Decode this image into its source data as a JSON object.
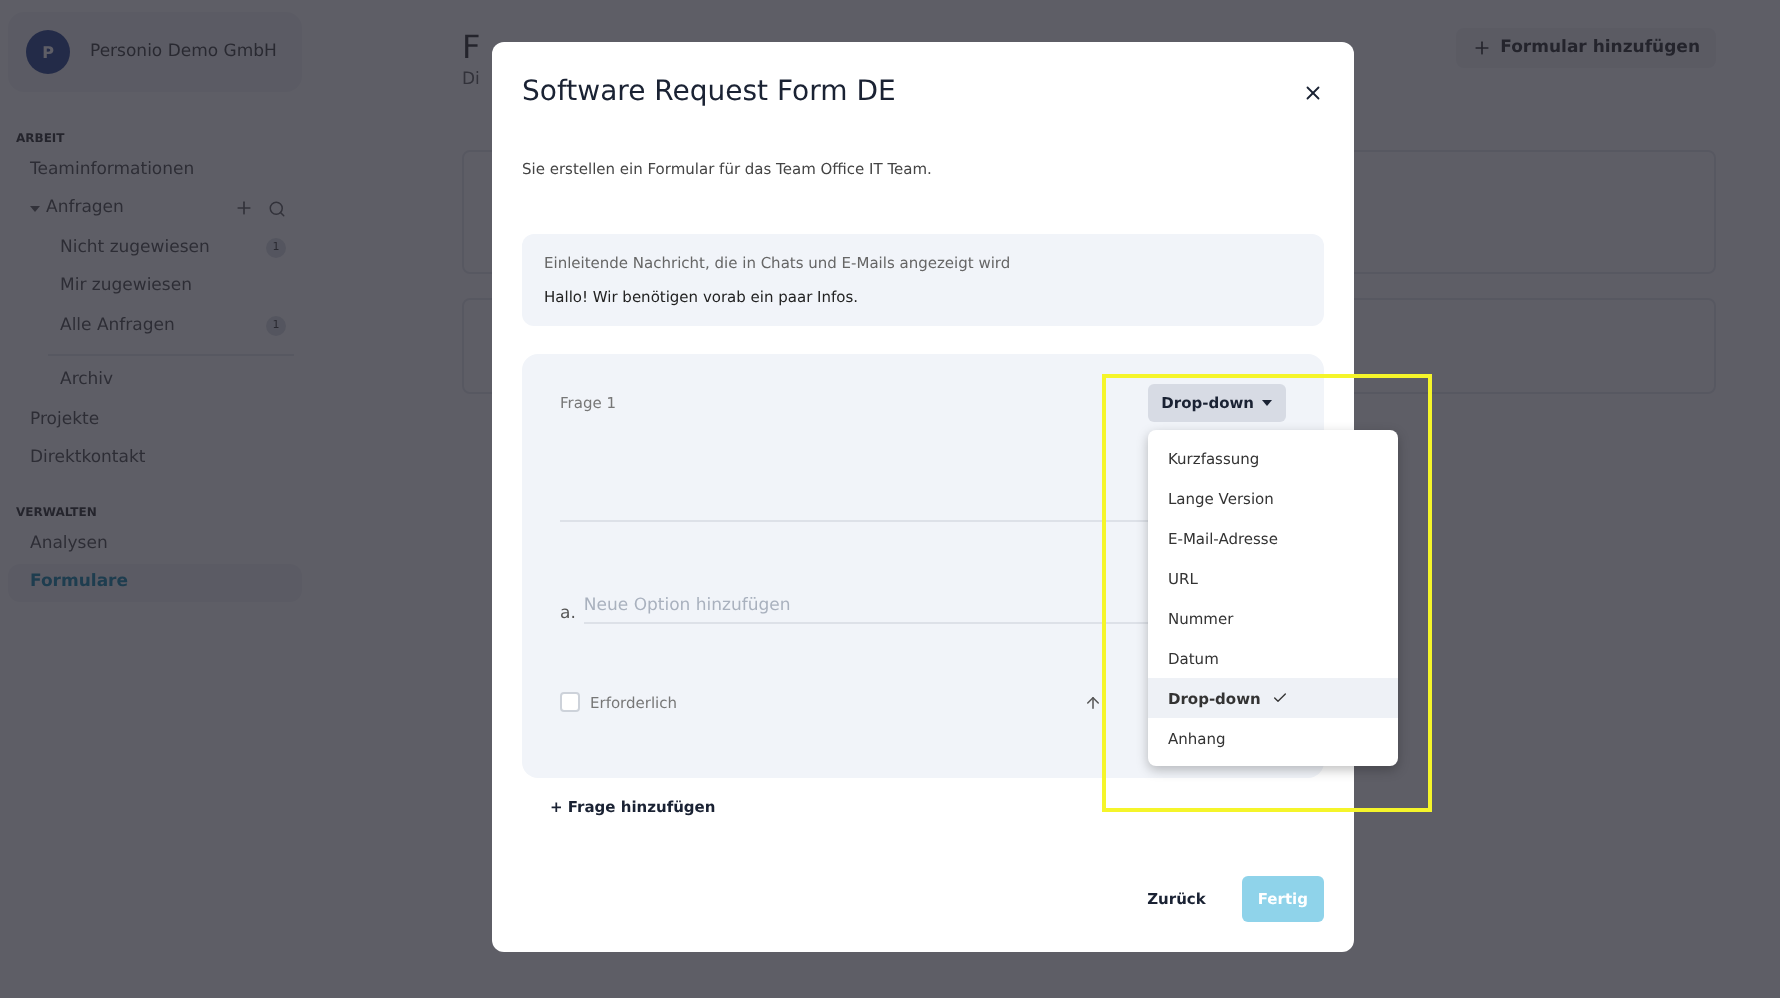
{
  "sidebar": {
    "company": {
      "avatar": "P",
      "name": "Personio Demo GmbH"
    },
    "sections": [
      {
        "heading": "ARBEIT",
        "items": [
          {
            "label": "Teaminformationen",
            "selected": false
          },
          {
            "label": "Anfragen",
            "selected": false,
            "expanded": true,
            "children": [
              {
                "label": "Nicht zugewiesen",
                "badge": "1",
                "selected": false
              },
              {
                "label": "Mir zugewiesen",
                "selected": false
              },
              {
                "label": "Alle Anfragen",
                "badge": "1",
                "selected": false
              },
              {
                "label": "Archiv",
                "selected": false
              }
            ]
          },
          {
            "label": "Projekte",
            "selected": false
          },
          {
            "label": "Direktkontakt",
            "selected": false
          }
        ]
      },
      {
        "heading": "VERWALTEN",
        "items": [
          {
            "label": "Analysen",
            "selected": false
          },
          {
            "label": "Formulare",
            "selected": true
          }
        ]
      }
    ]
  },
  "main": {
    "title": "F",
    "subtitle": "Di",
    "add_button": "Formular hinzufügen"
  },
  "modal": {
    "title": "Software Request Form DE",
    "description": "Sie erstellen ein Formular für das Team Office IT Team.",
    "intro": {
      "label": "Einleitende Nachricht, die in Chats und E-Mails angezeigt wird",
      "value": "Hallo! Wir benötigen vorab ein paar Infos."
    },
    "questions": [
      {
        "label": "Frage 1",
        "type_button": "Drop-down",
        "option_marker": "a.",
        "option_placeholder": "Neue Option hinzufügen",
        "required": {
          "label": "Erforderlich",
          "checked": false
        }
      }
    ],
    "type_menu": [
      {
        "label": "Kurzfassung",
        "selected": false
      },
      {
        "label": "Lange Version",
        "selected": false
      },
      {
        "label": "E-Mail-Adresse",
        "selected": false
      },
      {
        "label": "URL",
        "selected": false
      },
      {
        "label": "Nummer",
        "selected": false
      },
      {
        "label": "Datum",
        "selected": false
      },
      {
        "label": "Drop-down",
        "selected": true
      },
      {
        "label": "Anhang",
        "selected": false
      }
    ],
    "add_question": "+ Frage hinzufügen",
    "back_button": "Zurück",
    "done_button": {
      "label": "Fertig",
      "disabled": true
    }
  }
}
